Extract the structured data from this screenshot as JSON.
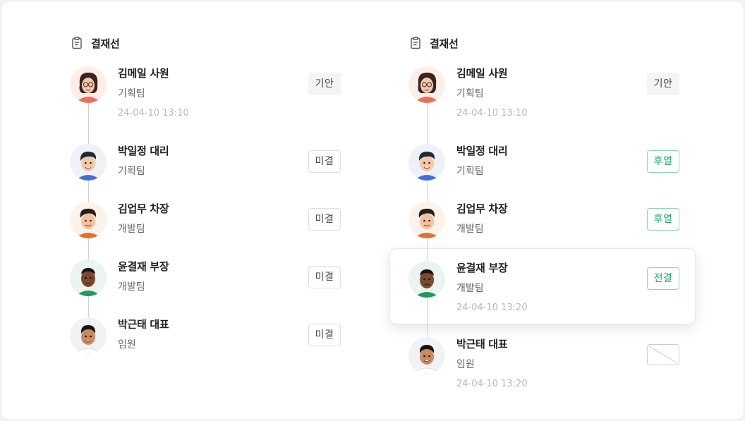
{
  "panels": [
    {
      "title": "결재선",
      "icon": "clipboard-icon",
      "rows": [
        {
          "name": "김메일 사원",
          "team": "기획팀",
          "date": "24-04-10 13:10",
          "badge": "기안",
          "badge_style": "gian",
          "avatar": "woman-glasses"
        },
        {
          "name": "박일정 대리",
          "team": "기획팀",
          "date": "",
          "badge": "미결",
          "badge_style": "mi",
          "avatar": "man-blue"
        },
        {
          "name": "김업무 차장",
          "team": "개발팀",
          "date": "",
          "badge": "미결",
          "badge_style": "mi",
          "avatar": "man-orange"
        },
        {
          "name": "윤결재 부장",
          "team": "개발팀",
          "date": "",
          "badge": "미결",
          "badge_style": "mi",
          "avatar": "man-green"
        },
        {
          "name": "박근태 대표",
          "team": "임원",
          "date": "",
          "badge": "미결",
          "badge_style": "mi",
          "avatar": "man-white"
        }
      ]
    },
    {
      "title": "결재선",
      "icon": "clipboard-icon",
      "rows": [
        {
          "name": "김메일 사원",
          "team": "기획팀",
          "date": "24-04-10 13:10",
          "badge": "기안",
          "badge_style": "gian",
          "avatar": "woman-glasses"
        },
        {
          "name": "박일정 대리",
          "team": "기획팀",
          "date": "",
          "badge": "후열",
          "badge_style": "green",
          "avatar": "man-blue"
        },
        {
          "name": "김업무 차장",
          "team": "개발팀",
          "date": "",
          "badge": "후열",
          "badge_style": "green",
          "avatar": "man-orange"
        },
        {
          "name": "윤결재 부장",
          "team": "개발팀",
          "date": "24-04-10 13:20",
          "badge": "전결",
          "badge_style": "green",
          "avatar": "man-green",
          "highlighted": true
        },
        {
          "name": "박근태 대표",
          "team": "임원",
          "date": "24-04-10 13:20",
          "badge": "",
          "badge_style": "empty",
          "avatar": "man-white"
        }
      ]
    }
  ],
  "colors": {
    "approved_green": "#27a56c",
    "connector": "#cfd2d7"
  }
}
